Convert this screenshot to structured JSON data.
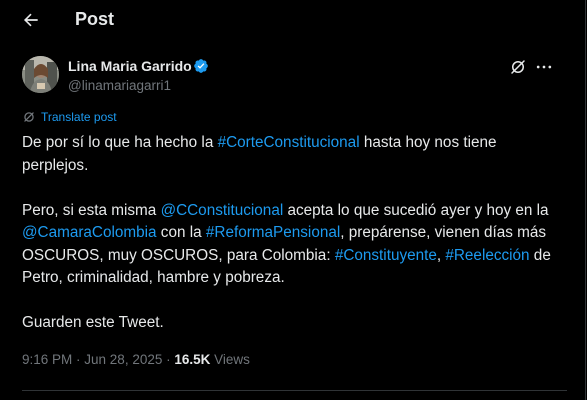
{
  "header": {
    "title": "Post"
  },
  "author": {
    "display_name": "Lina Maria Garrido",
    "handle": "@linamariagarri1"
  },
  "translate_label": "Translate post",
  "tweet": {
    "p1": {
      "t1": "De por sí lo que ha hecho la ",
      "l1": "#CorteConstitucional",
      "t2": " hasta hoy nos tiene perplejos."
    },
    "p2": {
      "t1": "Pero, si esta misma ",
      "l1": "@CConstitucional",
      "t2": " acepta lo que sucedió ayer y hoy en la ",
      "l2": "@CamaraColombia",
      "t3": " con la ",
      "l3": "#ReformaPensional",
      "t4": ", prepárense, vienen días más OSCUROS, muy OSCUROS, para Colombia: ",
      "l4": "#Constituyente",
      "t5": ", ",
      "l5": "#Reelección",
      "t6": " de Petro, criminalidad, hambre y pobreza."
    },
    "p3": {
      "t1": "Guarden este Tweet."
    }
  },
  "meta": {
    "time": "9:16 PM",
    "separator": " · ",
    "date": "Jun 28, 2025",
    "views_count": "16.5K",
    "views_label": " Views"
  },
  "colors": {
    "background": "#000000",
    "text": "#e7e9ea",
    "secondary": "#71767b",
    "link": "#1d9bf0",
    "verified": "#1d9bf0",
    "divider": "#2f3336"
  },
  "icons": {
    "back": "arrow-left-icon",
    "verified": "verified-badge-icon",
    "grok": "grok-icon",
    "more": "more-horizontal-icon",
    "translate": "translate-icon"
  }
}
